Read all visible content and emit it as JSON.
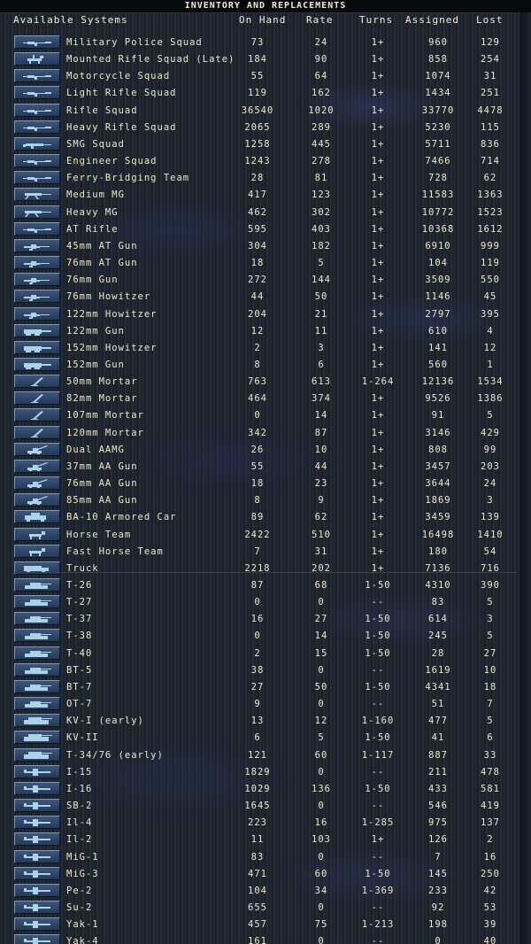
{
  "title": "INVENTORY AND REPLACEMENTS",
  "headers": {
    "system": "Available Systems",
    "on_hand": "On Hand",
    "rate": "Rate",
    "turns": "Turns",
    "assigned": "Assigned",
    "lost": "Lost"
  },
  "colors": {
    "text": "#efe9c8",
    "button": "#2f4668",
    "icon": "#a8d4e4"
  },
  "rows": [
    {
      "name": "Military Police Squad",
      "on_hand": "73",
      "rate": "24",
      "turns": "1+",
      "assigned": "960",
      "lost": "129",
      "icon": "rifle-icon"
    },
    {
      "name": "Mounted Rifle Squad (Late)",
      "on_hand": "184",
      "rate": "90",
      "turns": "1+",
      "assigned": "858",
      "lost": "254",
      "icon": "cavalry-icon"
    },
    {
      "name": "Motorcycle Squad",
      "on_hand": "55",
      "rate": "64",
      "turns": "1+",
      "assigned": "1074",
      "lost": "31",
      "icon": "rifle-icon"
    },
    {
      "name": "Light Rifle Squad",
      "on_hand": "119",
      "rate": "162",
      "turns": "1+",
      "assigned": "1434",
      "lost": "251",
      "icon": "rifle-icon"
    },
    {
      "name": "Rifle Squad",
      "on_hand": "36540",
      "rate": "1020",
      "turns": "1+",
      "assigned": "33770",
      "lost": "4478",
      "icon": "rifle-icon"
    },
    {
      "name": "Heavy Rifle Squad",
      "on_hand": "2065",
      "rate": "289",
      "turns": "1+",
      "assigned": "5230",
      "lost": "115",
      "icon": "rifle-icon"
    },
    {
      "name": "SMG Squad",
      "on_hand": "1258",
      "rate": "445",
      "turns": "1+",
      "assigned": "5711",
      "lost": "836",
      "icon": "smg-icon"
    },
    {
      "name": "Engineer Squad",
      "on_hand": "1243",
      "rate": "278",
      "turns": "1+",
      "assigned": "7466",
      "lost": "714",
      "icon": "rifle-icon"
    },
    {
      "name": "Ferry-Bridging Team",
      "on_hand": "28",
      "rate": "81",
      "turns": "1+",
      "assigned": "728",
      "lost": "62",
      "icon": "rifle-icon"
    },
    {
      "name": "Medium MG",
      "on_hand": "417",
      "rate": "123",
      "turns": "1+",
      "assigned": "11583",
      "lost": "1363",
      "icon": "machine-gun-icon"
    },
    {
      "name": "Heavy MG",
      "on_hand": "462",
      "rate": "302",
      "turns": "1+",
      "assigned": "10772",
      "lost": "1523",
      "icon": "machine-gun-icon"
    },
    {
      "name": "AT Rifle",
      "on_hand": "595",
      "rate": "403",
      "turns": "1+",
      "assigned": "10368",
      "lost": "1612",
      "icon": "rifle-icon"
    },
    {
      "name": "45mm AT Gun",
      "on_hand": "304",
      "rate": "182",
      "turns": "1+",
      "assigned": "6910",
      "lost": "999",
      "icon": "field-gun-icon"
    },
    {
      "name": "76mm AT Gun",
      "on_hand": "18",
      "rate": "5",
      "turns": "1+",
      "assigned": "104",
      "lost": "119",
      "icon": "field-gun-icon"
    },
    {
      "name": "76mm Gun",
      "on_hand": "272",
      "rate": "144",
      "turns": "1+",
      "assigned": "3509",
      "lost": "550",
      "icon": "field-gun-icon"
    },
    {
      "name": "76mm Howitzer",
      "on_hand": "44",
      "rate": "50",
      "turns": "1+",
      "assigned": "1146",
      "lost": "45",
      "icon": "field-gun-icon"
    },
    {
      "name": "122mm Howitzer",
      "on_hand": "204",
      "rate": "21",
      "turns": "1+",
      "assigned": "2797",
      "lost": "395",
      "icon": "field-gun-icon"
    },
    {
      "name": "122mm Gun",
      "on_hand": "12",
      "rate": "11",
      "turns": "1+",
      "assigned": "610",
      "lost": "4",
      "icon": "heavy-gun-icon"
    },
    {
      "name": "152mm Howitzer",
      "on_hand": "2",
      "rate": "3",
      "turns": "1+",
      "assigned": "141",
      "lost": "12",
      "icon": "heavy-gun-icon"
    },
    {
      "name": "152mm Gun",
      "on_hand": "8",
      "rate": "6",
      "turns": "1+",
      "assigned": "560",
      "lost": "1",
      "icon": "heavy-gun-icon"
    },
    {
      "name": "50mm Mortar",
      "on_hand": "763",
      "rate": "613",
      "turns": "1-264",
      "assigned": "12136",
      "lost": "1534",
      "icon": "mortar-icon"
    },
    {
      "name": "82mm Mortar",
      "on_hand": "464",
      "rate": "374",
      "turns": "1+",
      "assigned": "9526",
      "lost": "1386",
      "icon": "mortar-icon"
    },
    {
      "name": "107mm Mortar",
      "on_hand": "0",
      "rate": "14",
      "turns": "1+",
      "assigned": "91",
      "lost": "5",
      "icon": "mortar-icon"
    },
    {
      "name": "120mm Mortar",
      "on_hand": "342",
      "rate": "87",
      "turns": "1+",
      "assigned": "3146",
      "lost": "429",
      "icon": "mortar-icon"
    },
    {
      "name": "Dual AAMG",
      "on_hand": "26",
      "rate": "10",
      "turns": "1+",
      "assigned": "808",
      "lost": "99",
      "icon": "aa-gun-icon"
    },
    {
      "name": "37mm AA Gun",
      "on_hand": "55",
      "rate": "44",
      "turns": "1+",
      "assigned": "3457",
      "lost": "203",
      "icon": "aa-gun-icon"
    },
    {
      "name": "76mm AA Gun",
      "on_hand": "18",
      "rate": "23",
      "turns": "1+",
      "assigned": "3644",
      "lost": "24",
      "icon": "aa-gun-icon"
    },
    {
      "name": "85mm AA Gun",
      "on_hand": "8",
      "rate": "9",
      "turns": "1+",
      "assigned": "1869",
      "lost": "3",
      "icon": "aa-gun-icon"
    },
    {
      "name": "BA-10 Armored Car",
      "on_hand": "89",
      "rate": "62",
      "turns": "1+",
      "assigned": "3459",
      "lost": "139",
      "icon": "armored-car-icon"
    },
    {
      "name": "Horse Team",
      "on_hand": "2422",
      "rate": "510",
      "turns": "1+",
      "assigned": "16498",
      "lost": "1410",
      "icon": "horse-icon"
    },
    {
      "name": "Fast Horse Team",
      "on_hand": "7",
      "rate": "31",
      "turns": "1+",
      "assigned": "180",
      "lost": "54",
      "icon": "horse-icon"
    },
    {
      "name": "Truck",
      "on_hand": "2218",
      "rate": "202",
      "turns": "1+",
      "assigned": "7136",
      "lost": "716",
      "icon": "truck-icon"
    },
    {
      "name": "T-26",
      "on_hand": "87",
      "rate": "68",
      "turns": "1-50",
      "assigned": "4310",
      "lost": "390",
      "icon": "tank-icon"
    },
    {
      "name": "T-27",
      "on_hand": "0",
      "rate": "0",
      "turns": "--",
      "assigned": "83",
      "lost": "5",
      "icon": "tank-icon"
    },
    {
      "name": "T-37",
      "on_hand": "16",
      "rate": "27",
      "turns": "1-50",
      "assigned": "614",
      "lost": "3",
      "icon": "tank-icon"
    },
    {
      "name": "T-38",
      "on_hand": "0",
      "rate": "14",
      "turns": "1-50",
      "assigned": "245",
      "lost": "5",
      "icon": "tank-icon"
    },
    {
      "name": "T-40",
      "on_hand": "2",
      "rate": "15",
      "turns": "1-50",
      "assigned": "28",
      "lost": "27",
      "icon": "tank-icon"
    },
    {
      "name": "BT-5",
      "on_hand": "38",
      "rate": "0",
      "turns": "--",
      "assigned": "1619",
      "lost": "10",
      "icon": "tank-icon"
    },
    {
      "name": "BT-7",
      "on_hand": "27",
      "rate": "50",
      "turns": "1-50",
      "assigned": "4341",
      "lost": "18",
      "icon": "tank-icon"
    },
    {
      "name": "OT-7",
      "on_hand": "9",
      "rate": "0",
      "turns": "--",
      "assigned": "51",
      "lost": "7",
      "icon": "tank-icon"
    },
    {
      "name": "KV-I (early)",
      "on_hand": "13",
      "rate": "12",
      "turns": "1-160",
      "assigned": "477",
      "lost": "5",
      "icon": "heavy-tank-icon"
    },
    {
      "name": "KV-II",
      "on_hand": "6",
      "rate": "5",
      "turns": "1-50",
      "assigned": "41",
      "lost": "6",
      "icon": "heavy-tank-icon"
    },
    {
      "name": "T-34/76 (early)",
      "on_hand": "121",
      "rate": "60",
      "turns": "1-117",
      "assigned": "887",
      "lost": "33",
      "icon": "heavy-tank-icon"
    },
    {
      "name": "I-15",
      "on_hand": "1829",
      "rate": "0",
      "turns": "--",
      "assigned": "211",
      "lost": "478",
      "icon": "aircraft-icon"
    },
    {
      "name": "I-16",
      "on_hand": "1029",
      "rate": "136",
      "turns": "1-50",
      "assigned": "433",
      "lost": "581",
      "icon": "aircraft-icon"
    },
    {
      "name": "SB-2",
      "on_hand": "1645",
      "rate": "0",
      "turns": "--",
      "assigned": "546",
      "lost": "419",
      "icon": "aircraft-icon"
    },
    {
      "name": "Il-4",
      "on_hand": "223",
      "rate": "16",
      "turns": "1-285",
      "assigned": "975",
      "lost": "137",
      "icon": "aircraft-icon"
    },
    {
      "name": "Il-2",
      "on_hand": "11",
      "rate": "103",
      "turns": "1+",
      "assigned": "126",
      "lost": "2",
      "icon": "aircraft-icon"
    },
    {
      "name": "MiG-1",
      "on_hand": "83",
      "rate": "0",
      "turns": "--",
      "assigned": "7",
      "lost": "16",
      "icon": "aircraft-icon"
    },
    {
      "name": "MiG-3",
      "on_hand": "471",
      "rate": "60",
      "turns": "1-50",
      "assigned": "145",
      "lost": "250",
      "icon": "aircraft-icon"
    },
    {
      "name": "Pe-2",
      "on_hand": "104",
      "rate": "34",
      "turns": "1-369",
      "assigned": "233",
      "lost": "42",
      "icon": "aircraft-icon"
    },
    {
      "name": "Su-2",
      "on_hand": "655",
      "rate": "0",
      "turns": "--",
      "assigned": "92",
      "lost": "53",
      "icon": "aircraft-icon"
    },
    {
      "name": "Yak-1",
      "on_hand": "457",
      "rate": "75",
      "turns": "1-213",
      "assigned": "198",
      "lost": "39",
      "icon": "aircraft-icon"
    },
    {
      "name": "Yak-4",
      "on_hand": "161",
      "rate": "0",
      "turns": "--",
      "assigned": "0",
      "lost": "40",
      "icon": "aircraft-icon"
    }
  ]
}
